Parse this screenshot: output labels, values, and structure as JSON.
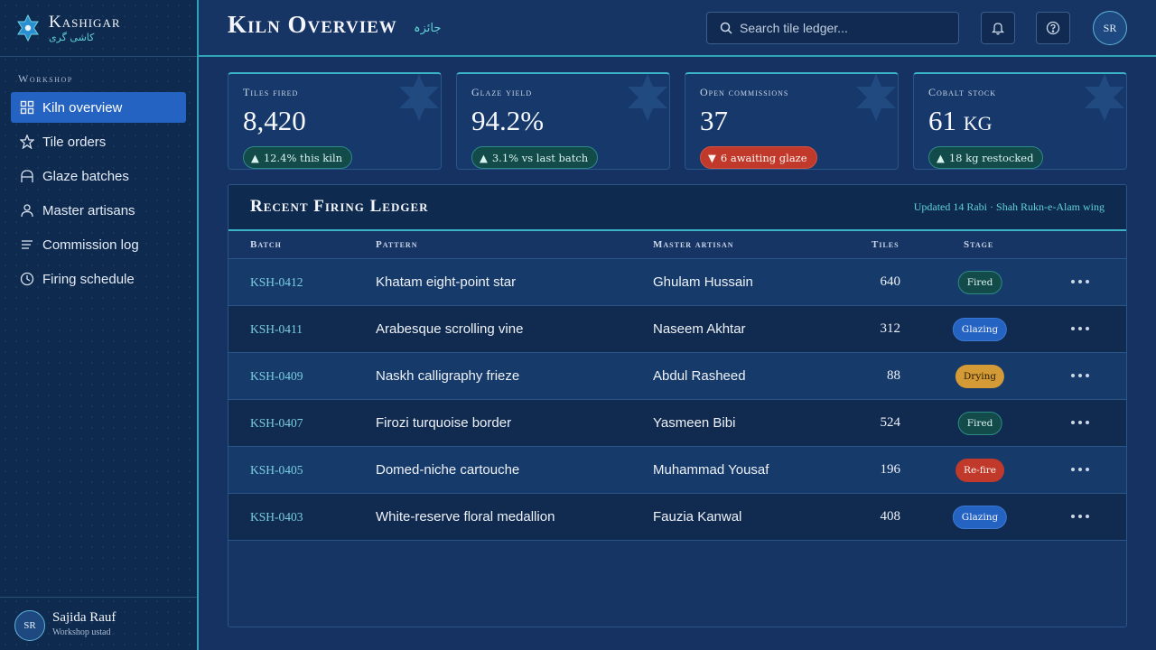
{
  "brand": {
    "name": "Kashigar",
    "subtitle": "کاشی گری"
  },
  "sidebar": {
    "section": "Workshop",
    "items": [
      {
        "label": "Kiln overview",
        "icon": "grid-icon",
        "active": true
      },
      {
        "label": "Tile orders",
        "icon": "star-icon",
        "active": false
      },
      {
        "label": "Glaze batches",
        "icon": "arch-icon",
        "active": false
      },
      {
        "label": "Master artisans",
        "icon": "user-icon",
        "active": false
      },
      {
        "label": "Commission log",
        "icon": "list-icon",
        "active": false
      },
      {
        "label": "Firing schedule",
        "icon": "clock-icon",
        "active": false
      }
    ]
  },
  "user": {
    "initials": "SR",
    "name": "Sajida Rauf",
    "role": "Workshop ustad"
  },
  "header": {
    "title": "Kiln Overview",
    "title_urdu": "جائزہ",
    "search_placeholder": "Search tile ledger..."
  },
  "stats": [
    {
      "label": "Tiles fired",
      "value": "8,420",
      "badge": "12.4% this kiln",
      "trend": "up"
    },
    {
      "label": "Glaze yield",
      "value": "94.2%",
      "badge": "3.1% vs last batch",
      "trend": "up"
    },
    {
      "label": "Open commissions",
      "value": "37",
      "badge": "6 awaiting glaze",
      "trend": "down"
    },
    {
      "label": "Cobalt stock",
      "value": "61 kg",
      "badge": "18 kg restocked",
      "trend": "up"
    }
  ],
  "ledger": {
    "title": "Recent Firing Ledger",
    "meta": "Updated 14 Rabi · Shah Rukn-e-Alam wing",
    "columns": {
      "batch": "Batch",
      "pattern": "Pattern",
      "artisan": "Master artisan",
      "tiles": "Tiles",
      "stage": "Stage"
    },
    "rows": [
      {
        "batch": "KSH-0412",
        "pattern": "Khatam eight-point star",
        "artisan": "Ghulam Hussain",
        "tiles": "640",
        "stage": "Fired",
        "stage_kind": "fired"
      },
      {
        "batch": "KSH-0411",
        "pattern": "Arabesque scrolling vine",
        "artisan": "Naseem Akhtar",
        "tiles": "312",
        "stage": "Glazing",
        "stage_kind": "glazing"
      },
      {
        "batch": "KSH-0409",
        "pattern": "Naskh calligraphy frieze",
        "artisan": "Abdul Rasheed",
        "tiles": "88",
        "stage": "Drying",
        "stage_kind": "drying"
      },
      {
        "batch": "KSH-0407",
        "pattern": "Firozi turquoise border",
        "artisan": "Yasmeen Bibi",
        "tiles": "524",
        "stage": "Fired",
        "stage_kind": "fired"
      },
      {
        "batch": "KSH-0405",
        "pattern": "Domed-niche cartouche",
        "artisan": "Muhammad Yousaf",
        "tiles": "196",
        "stage": "Re-fire",
        "stage_kind": "refire"
      },
      {
        "batch": "KSH-0403",
        "pattern": "White-reserve floral medallion",
        "artisan": "Fauzia Kanwal",
        "tiles": "408",
        "stage": "Glazing",
        "stage_kind": "glazing"
      }
    ]
  },
  "colors": {
    "accent": "#3cb4c8",
    "active_nav": "#2563c2",
    "fired": "#134a4a",
    "glazing": "#2563c2",
    "drying": "#d39a35",
    "refire": "#c0392b"
  }
}
